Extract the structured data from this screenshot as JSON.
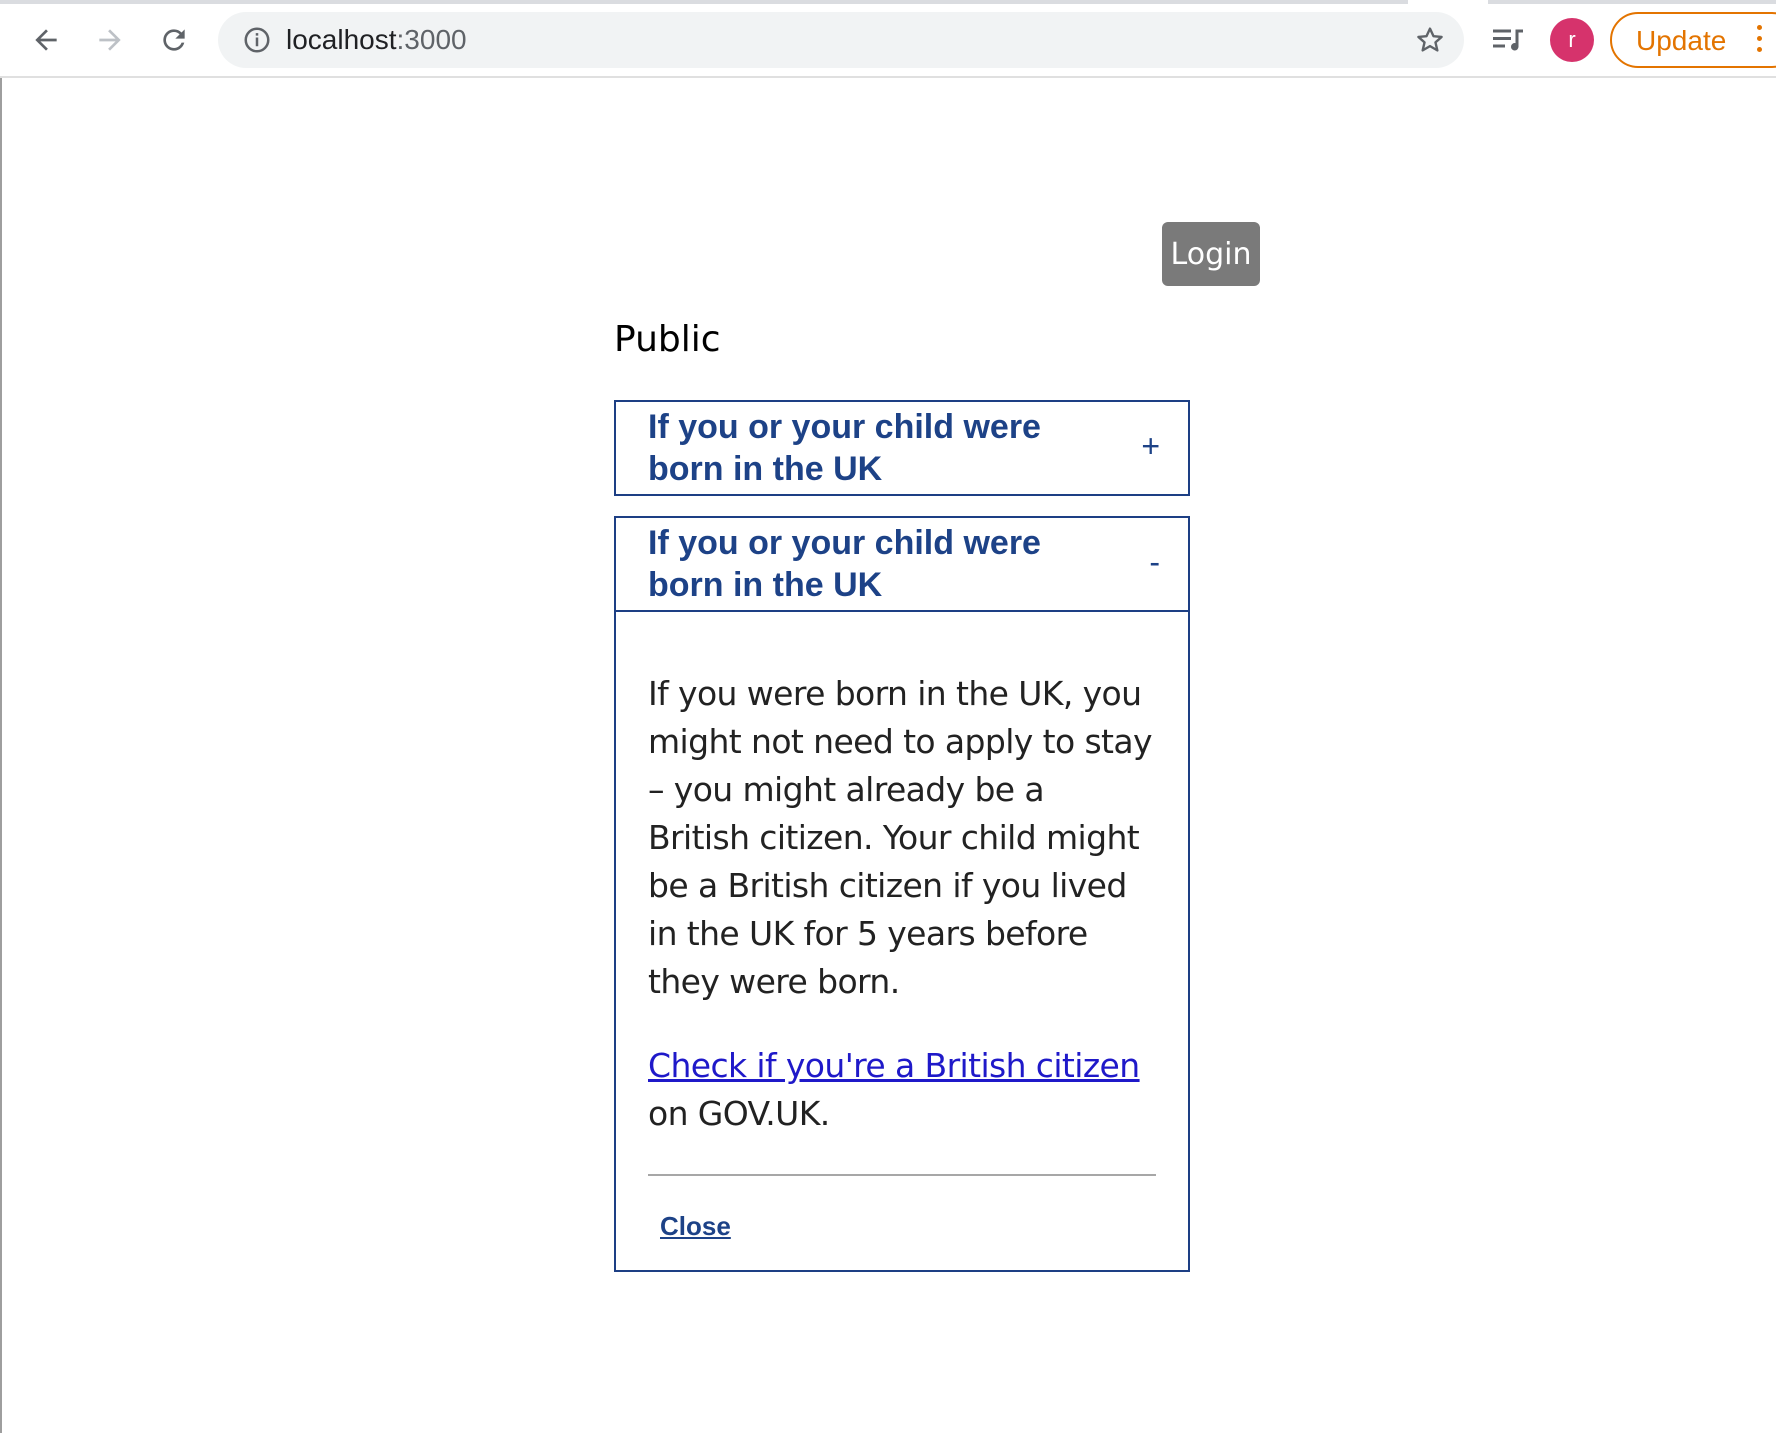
{
  "browser": {
    "url_host": "localhost",
    "url_port": ":3000",
    "profile_initial": "r",
    "update_label": "Update",
    "update_color": "#e37400",
    "avatar_color": "#d6336c",
    "icons": [
      "back-arrow-icon",
      "forward-arrow-icon",
      "reload-icon",
      "info-icon",
      "star-icon",
      "media-queue-icon",
      "kebab-menu-icon"
    ]
  },
  "header": {
    "login_label": "Login"
  },
  "page": {
    "heading": "Public",
    "accent_color": "#1d4287"
  },
  "accordions": [
    {
      "title": "If you or your child were born in the UK",
      "toggle": "+",
      "expanded": false
    },
    {
      "title": "If you or your child were born in the UK",
      "toggle": "-",
      "expanded": true,
      "body_text": "If you were born in the UK, you might not need to apply to stay – you might already be a British citizen. Your child might be a British citizen if you lived in the UK for 5 years before they were born.",
      "link_text": "Check if you're a British citizen",
      "link_suffix": " on GOV.UK.",
      "close_label": "Close"
    }
  ]
}
